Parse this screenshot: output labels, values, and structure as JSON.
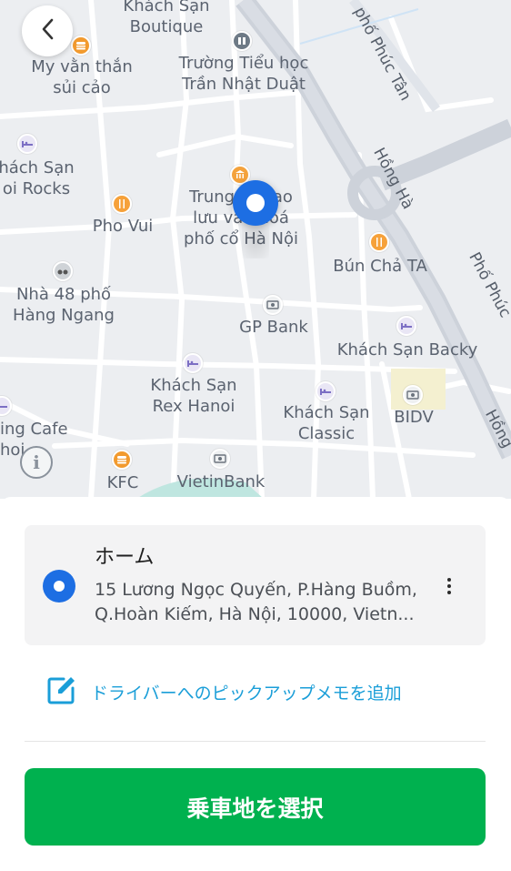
{
  "map": {
    "labels": {
      "khach_san_boutique": "Khách Sạn\nBoutique",
      "my_van_than": "My vằn thắn\nsủi cảo",
      "truong_tieu_hoc": "Trường Tiểu học\nTrần Nhật Duật",
      "pho_phuc_tan_top": "phố Phúc Tân",
      "khach_san_hanoi_rocks": "hách Sạn\noi Rocks",
      "pho_vui": "Pho Vui",
      "trung_tam": "Trung    Giao\nlưu văn hoá\nphố cổ Hà Nội",
      "hong_ha_1": "Hồng Hà",
      "bun_cha_ta": "Bún Chả TA",
      "pho_phuc_right": "Phố Phúc",
      "nha_48": "Nhà 48 phố\nHàng Ngang",
      "gp_bank": "GP Bank",
      "khach_san_backy": "Khách Sạn Backy",
      "khach_san_rex": "Khách Sạn\nRex Hanoi",
      "khach_san_classic": "Khách Sạn\nClassic",
      "bidv": "BIDV",
      "hong_ha_2": "Hồng",
      "ing_cafe": "ing Cafe\nhoi",
      "kfc": "KFC",
      "vietinbank": "VietinBank"
    },
    "icons": {
      "back": "chevron-left-icon",
      "pin": "location-pin-icon",
      "info": "info-icon"
    }
  },
  "address": {
    "title": "ホーム",
    "line1": "15 Lương Ngọc Quyến, P.Hàng Buồm,",
    "line2": "Q.Hoàn Kiếm, Hà Nội, 10000, Vietn..."
  },
  "memo": {
    "label": "ドライバーへのピックアップメモを追加"
  },
  "confirm": {
    "label": "乗車地を選択"
  },
  "colors": {
    "accent_green": "#00b14f",
    "pin_blue": "#1d6ee3",
    "link_blue": "#1a9ed8"
  }
}
